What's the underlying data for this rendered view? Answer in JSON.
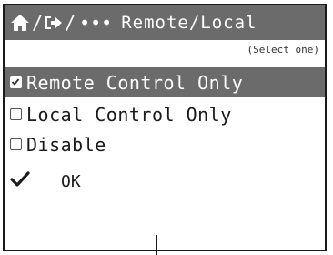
{
  "title_bar": {
    "home_icon": "home-icon",
    "separator_1": "/",
    "exit_icon": "exit-arrow-icon",
    "separator_2": "/",
    "ellipsis": "•••",
    "title": "Remote/Local"
  },
  "hint": "(Select one)",
  "options": [
    {
      "label": "Remote Control Only",
      "checked": true,
      "selected": true
    },
    {
      "label": "Local Control Only",
      "checked": false,
      "selected": false
    },
    {
      "label": "Disable",
      "checked": false,
      "selected": false
    }
  ],
  "ok": {
    "icon": "checkmark-icon",
    "label": "OK"
  },
  "colors": {
    "highlight": "#6b6b6b",
    "text": "#1a1a1a",
    "background": "#ffffff"
  }
}
